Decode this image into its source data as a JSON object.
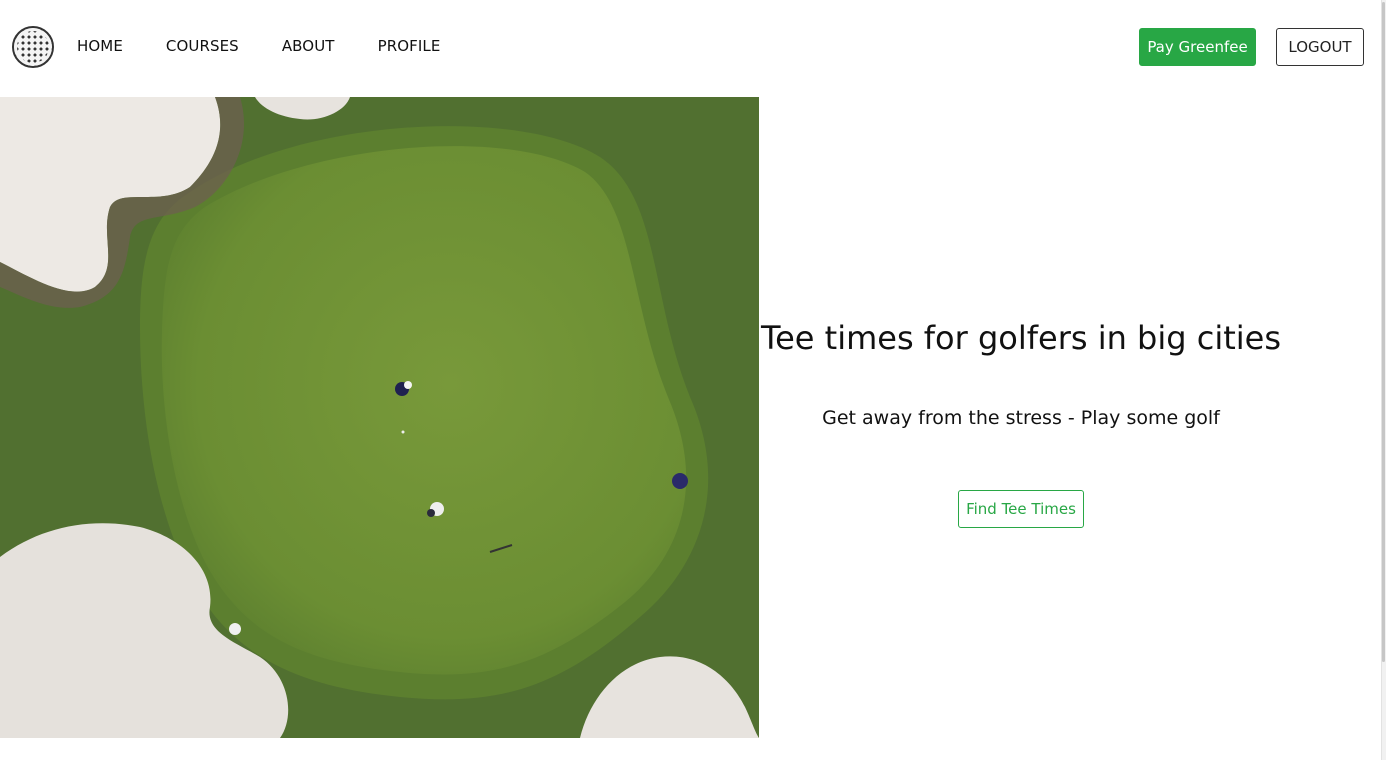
{
  "nav": {
    "logo_icon": "golf-ball-icon",
    "links": [
      "HOME",
      "COURSES",
      "ABOUT",
      "PROFILE"
    ],
    "pay_button": "Pay Greenfee",
    "logout_button": "LOGOUT"
  },
  "hero": {
    "image": "aerial-golf-green",
    "headline": "Tee times for golfers in big cities",
    "subline": "Get away from the stress - Play some golf",
    "cta_button": "Find Tee Times"
  },
  "colors": {
    "accent": "#28a745",
    "grass_green": "#6b8e34",
    "rough": "#4e6f2c",
    "sand": "#e7e3de"
  }
}
